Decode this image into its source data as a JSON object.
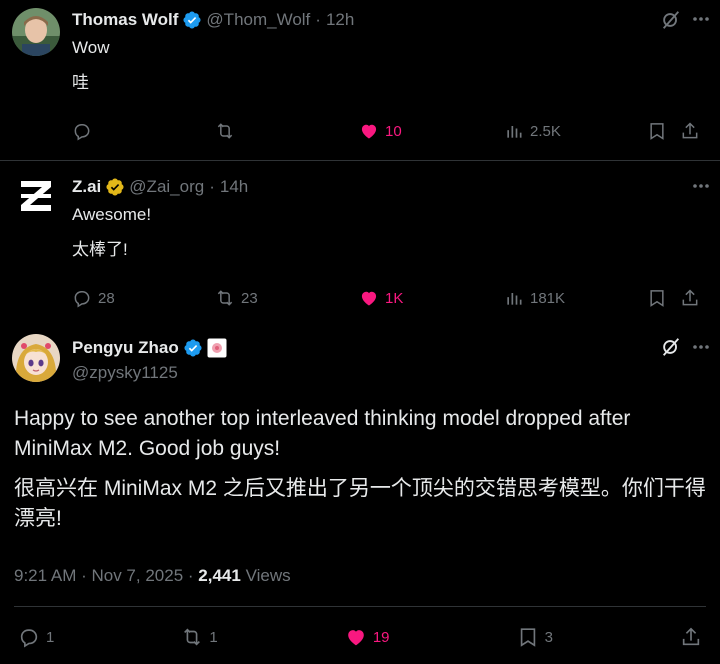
{
  "tweets": [
    {
      "name": "Thomas Wolf",
      "handle": "@Thom_Wolf",
      "time": "12h",
      "lines": [
        "Wow",
        "哇"
      ],
      "actions": {
        "replies": "",
        "retweets": "",
        "likes": "10",
        "views": "2.5K"
      }
    },
    {
      "name": "Z.ai",
      "handle": "@Zai_org",
      "time": "14h",
      "lines": [
        "Awesome!",
        "太棒了!"
      ],
      "actions": {
        "replies": "28",
        "retweets": "23",
        "likes": "1K",
        "views": "181K"
      }
    }
  ],
  "main": {
    "name": "Pengyu Zhao",
    "handle": "@zpysky1125",
    "paragraphs": [
      "Happy to see another top interleaved thinking model dropped after MiniMax M2. Good job guys!",
      "很高兴在 MiniMax M2 之后又推出了另一个顶尖的交错思考模型。你们干得漂亮!"
    ],
    "timestamp": "9:21 AM · Nov 7, 2025 ·",
    "views_count": "2,441",
    "views_label": "Views",
    "actions": {
      "replies": "1",
      "retweets": "1",
      "likes": "19",
      "bookmarks": "3"
    }
  },
  "colors": {
    "like": "#f91880",
    "verified_blue": "#1d9bf0",
    "verified_gold": "#e2b719",
    "muted": "#71767b"
  },
  "icons": [
    "reply-icon",
    "retweet-icon",
    "like-icon",
    "views-icon",
    "bookmark-icon",
    "share-icon",
    "grok-icon",
    "more-icon",
    "verified-icon"
  ]
}
